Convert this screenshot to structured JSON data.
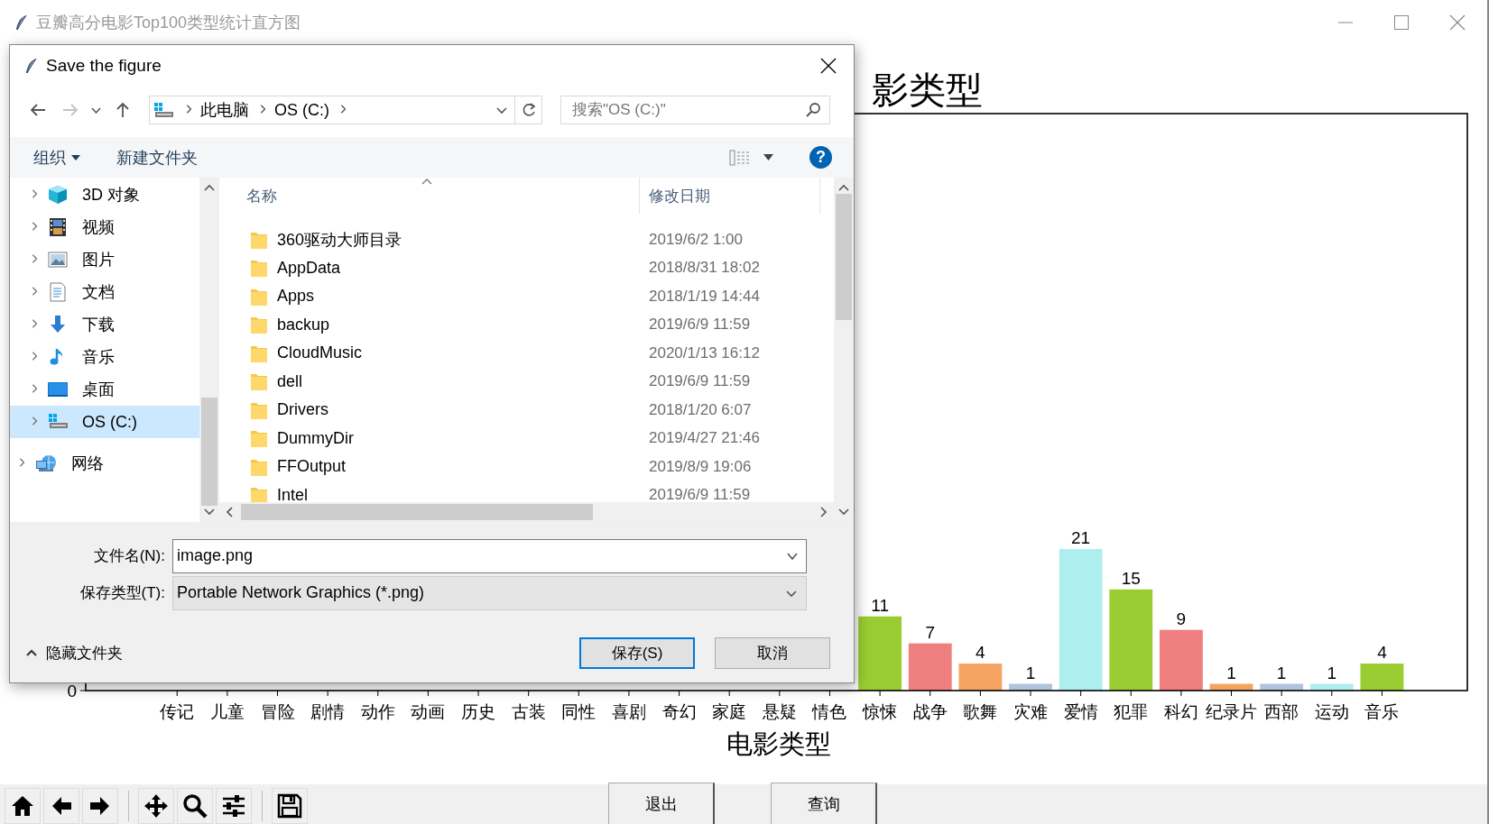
{
  "window": {
    "title": "豆瓣高分电影Top100类型统计直方图"
  },
  "figure": {
    "chart_data": {
      "type": "bar",
      "title": "影类型",
      "xlabel": "电影类型",
      "categories": [
        "传记",
        "儿童",
        "冒险",
        "剧情",
        "动作",
        "动画",
        "历史",
        "古装",
        "同性",
        "喜剧",
        "奇幻",
        "家庭",
        "悬疑",
        "情色",
        "惊悚",
        "战争",
        "歌舞",
        "灾难",
        "爱情",
        "犯罪",
        "科幻",
        "纪录片",
        "西部",
        "运动",
        "音乐"
      ],
      "series": [
        {
          "color": [
            null,
            null,
            null,
            null,
            null,
            null,
            null,
            null,
            null,
            null,
            null,
            null,
            null,
            null,
            "#9acd32",
            "#f08080",
            "#f4a460",
            "#b0c4de",
            "#afeeee",
            "#9acd32",
            "#f08080",
            "#f4a460",
            "#b0c4de",
            "#afeeee",
            "#9acd32"
          ],
          "values": [
            null,
            null,
            null,
            null,
            null,
            null,
            null,
            null,
            null,
            null,
            null,
            null,
            null,
            null,
            11,
            7,
            4,
            1,
            21,
            15,
            9,
            1,
            1,
            1,
            4
          ]
        }
      ],
      "annotations": [
        {
          "text": "0"
        }
      ],
      "data_labels": true
    }
  },
  "toolbar": {
    "buttons": [
      "退出",
      "查询"
    ]
  },
  "dialog": {
    "title": "Save the figure",
    "address": [
      "此电脑",
      "OS (C:)"
    ],
    "search": {
      "placeholder": "搜索\"OS (C:)\""
    },
    "commands": [
      "组织",
      "新建文件夹"
    ],
    "help": "?",
    "nav": {
      "pc_items": [
        {
          "label": "3D 对象",
          "kind": "cube",
          "selected": false
        },
        {
          "label": "视频",
          "kind": "film",
          "selected": false
        },
        {
          "label": "图片",
          "kind": "image",
          "selected": false
        },
        {
          "label": "文档",
          "kind": "document",
          "selected": false
        },
        {
          "label": "下载",
          "kind": "download",
          "selected": false
        },
        {
          "label": "音乐",
          "kind": "music",
          "selected": false
        },
        {
          "label": "桌面",
          "kind": "desktop",
          "selected": false
        },
        {
          "label": "OS (C:)",
          "kind": "drive",
          "selected": true
        }
      ],
      "network": {
        "label": "网络",
        "selected": false
      }
    },
    "columns": [
      "名称",
      "修改日期"
    ],
    "files": [
      {
        "name": "360驱动大师目录",
        "modified": "2019/6/2 1:00"
      },
      {
        "name": "AppData",
        "modified": "2018/8/31 18:02"
      },
      {
        "name": "Apps",
        "modified": "2018/1/19 14:44"
      },
      {
        "name": "backup",
        "modified": "2019/6/9 11:59"
      },
      {
        "name": "CloudMusic",
        "modified": "2020/1/13 16:12"
      },
      {
        "name": "dell",
        "modified": "2019/6/9 11:59"
      },
      {
        "name": "Drivers",
        "modified": "2018/1/20 6:07"
      },
      {
        "name": "DummyDir",
        "modified": "2019/4/27 21:46"
      },
      {
        "name": "FFOutput",
        "modified": "2019/8/9 19:06"
      },
      {
        "name": "Intel",
        "modified": "2019/6/9 11:59"
      }
    ],
    "filename": {
      "label": "文件名(N):",
      "value": "image.png"
    },
    "filetype": {
      "label": "保存类型(T):",
      "value": "Portable Network Graphics (*.png)"
    },
    "hide_folders": "隐藏文件夹",
    "buttons": [
      {
        "label": "保存(S)",
        "default": true
      },
      {
        "label": "取消",
        "default": false
      }
    ]
  }
}
